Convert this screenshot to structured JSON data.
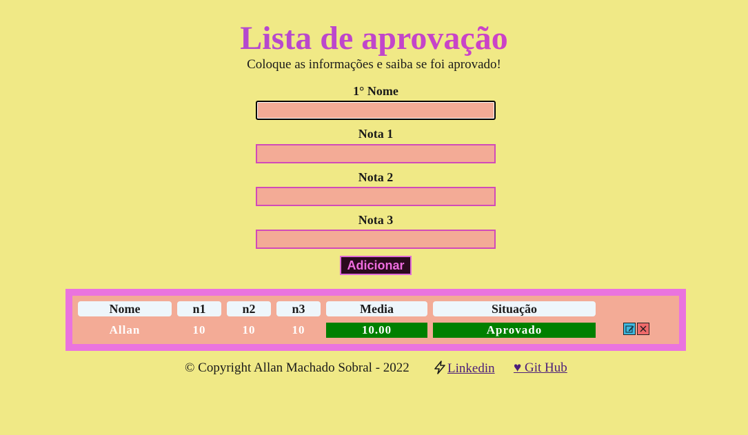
{
  "header": {
    "title": "Lista de aprovação",
    "subtitle": "Coloque as informações e saiba se foi aprovado!"
  },
  "form": {
    "name_label": "1° Nome",
    "name_value": "",
    "nota1_label": "Nota 1",
    "nota1_value": "",
    "nota2_label": "Nota 2",
    "nota2_value": "",
    "nota3_label": "Nota 3",
    "nota3_value": "",
    "add_button_label": "Adicionar"
  },
  "table": {
    "headers": [
      "Nome",
      "n1",
      "n2",
      "n3",
      "Media",
      "Situação"
    ],
    "rows": [
      [
        "Allan",
        "10",
        "10",
        "10",
        "10.00",
        "Aprovado"
      ]
    ],
    "row_actions": {
      "edit_icon": "edit-icon",
      "delete_icon": "close-icon"
    }
  },
  "footer": {
    "copyright": "© Copyright Allan Machado Sobral - 2022",
    "linkedin_label": "Linkedin",
    "github_label": "♥ Git Hub"
  },
  "colors": {
    "page_background": "#f0e986",
    "input_background": "#f3ab96",
    "table_border": "#ea74de",
    "approved_green": "#008000"
  }
}
